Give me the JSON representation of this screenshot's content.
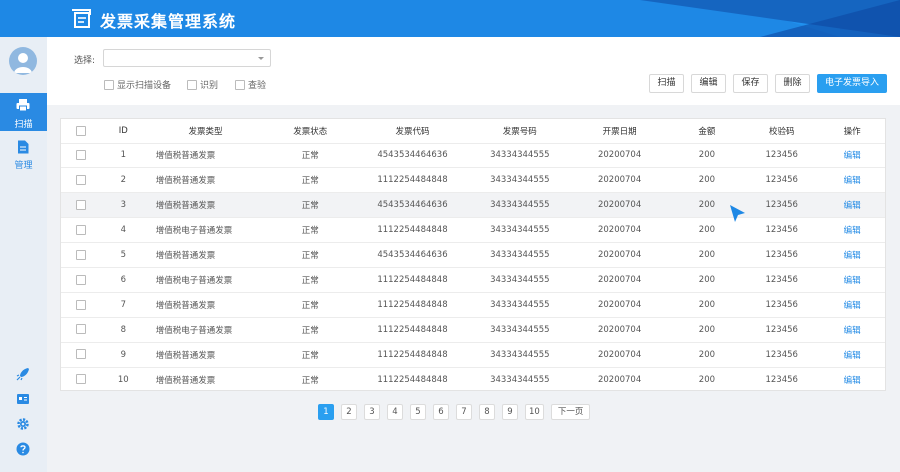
{
  "app": {
    "title": "发票采集管理系统"
  },
  "sidebar": {
    "items": [
      {
        "label": "扫描"
      },
      {
        "label": "管理"
      }
    ]
  },
  "toolbar": {
    "select_label": "选择:",
    "select_value": "",
    "checkboxes": [
      {
        "label": "显示扫描设备"
      },
      {
        "label": "识别"
      },
      {
        "label": "查验"
      }
    ],
    "buttons": {
      "scan": "扫描",
      "edit": "编辑",
      "save": "保存",
      "delete": "删除",
      "import": "电子发票导入"
    }
  },
  "table": {
    "headers": [
      "ID",
      "发票类型",
      "发票状态",
      "发票代码",
      "发票号码",
      "开票日期",
      "金额",
      "校验码",
      "操作"
    ],
    "rows": [
      {
        "id": "1",
        "type": "增值税普通发票",
        "status": "正常",
        "code": "4543534464636",
        "number": "34334344555",
        "date": "20200704",
        "amount": "200",
        "check": "123456",
        "action": "编辑"
      },
      {
        "id": "2",
        "type": "增值税普通发票",
        "status": "正常",
        "code": "1112254484848",
        "number": "34334344555",
        "date": "20200704",
        "amount": "200",
        "check": "123456",
        "action": "编辑"
      },
      {
        "id": "3",
        "type": "增值税普通发票",
        "status": "正常",
        "code": "4543534464636",
        "number": "34334344555",
        "date": "20200704",
        "amount": "200",
        "check": "123456",
        "action": "编辑"
      },
      {
        "id": "4",
        "type": "增值税电子普通发票",
        "status": "正常",
        "code": "1112254484848",
        "number": "34334344555",
        "date": "20200704",
        "amount": "200",
        "check": "123456",
        "action": "编辑"
      },
      {
        "id": "5",
        "type": "增值税普通发票",
        "status": "正常",
        "code": "4543534464636",
        "number": "34334344555",
        "date": "20200704",
        "amount": "200",
        "check": "123456",
        "action": "编辑"
      },
      {
        "id": "6",
        "type": "增值税电子普通发票",
        "status": "正常",
        "code": "1112254484848",
        "number": "34334344555",
        "date": "20200704",
        "amount": "200",
        "check": "123456",
        "action": "编辑"
      },
      {
        "id": "7",
        "type": "增值税普通发票",
        "status": "正常",
        "code": "1112254484848",
        "number": "34334344555",
        "date": "20200704",
        "amount": "200",
        "check": "123456",
        "action": "编辑"
      },
      {
        "id": "8",
        "type": "增值税电子普通发票",
        "status": "正常",
        "code": "1112254484848",
        "number": "34334344555",
        "date": "20200704",
        "amount": "200",
        "check": "123456",
        "action": "编辑"
      },
      {
        "id": "9",
        "type": "增值税普通发票",
        "status": "正常",
        "code": "1112254484848",
        "number": "34334344555",
        "date": "20200704",
        "amount": "200",
        "check": "123456",
        "action": "编辑"
      },
      {
        "id": "10",
        "type": "增值税普通发票",
        "status": "正常",
        "code": "1112254484848",
        "number": "34334344555",
        "date": "20200704",
        "amount": "200",
        "check": "123456",
        "action": "编辑"
      }
    ]
  },
  "pagination": {
    "pages": [
      "1",
      "2",
      "3",
      "4",
      "5",
      "6",
      "7",
      "8",
      "9",
      "10"
    ],
    "current": "1",
    "next_label": "下一页"
  },
  "colors": {
    "header": "#1e88e5",
    "accent": "#2a9ff0",
    "link": "#1e88e5"
  }
}
